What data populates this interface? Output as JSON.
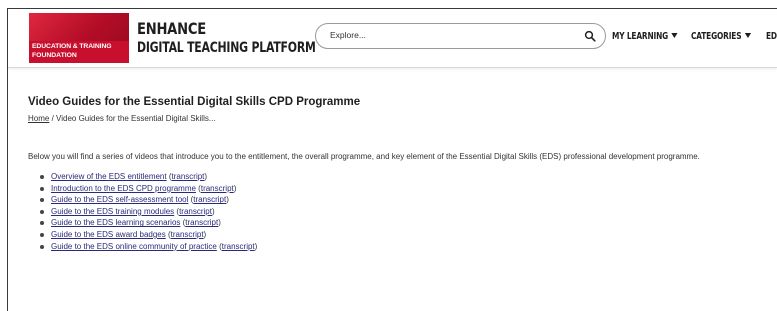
{
  "header": {
    "logo": {
      "line1": "EDUCATION & TRAINING",
      "line2": "FOUNDATION"
    },
    "brand_title": "ENHANCE",
    "brand_subtitle": "DIGITAL TEACHING PLATFORM",
    "search": {
      "placeholder": "Explore...",
      "icon": "search-icon"
    },
    "nav": [
      {
        "label": "MY LEARNING",
        "icon": "chevron-down-icon"
      },
      {
        "label": "CATEGORIES",
        "icon": "chevron-down-icon"
      },
      {
        "label": "EDS"
      }
    ]
  },
  "page": {
    "title": "Video Guides for the Essential Digital Skills CPD Programme",
    "breadcrumb": {
      "home": "Home",
      "separator": "/",
      "current": "Video Guides for the Essential Digital Skills..."
    },
    "intro": "Below you will find a series of videos that introduce you to the entitlement, the overall programme, and key element of the Essential Digital Skills (EDS) professional development programme.",
    "videos": [
      {
        "title": "Overview of the EDS entitlement",
        "transcript": "transcript"
      },
      {
        "title": "Introduction to the EDS CPD programme",
        "transcript": "transcript"
      },
      {
        "title": "Guide to the EDS self-assessment tool",
        "transcript": "transcript"
      },
      {
        "title": "Guide to the EDS training modules",
        "transcript": "transcript"
      },
      {
        "title": "Guide to the EDS learning scenarios",
        "transcript": "transcript"
      },
      {
        "title": "Guide to the EDS award badges",
        "transcript": "transcript"
      },
      {
        "title": "Guide to the EDS online community of practice",
        "transcript": "transcript"
      }
    ]
  },
  "colors": {
    "brand_red": "#c8102e",
    "link": "#2a2a7a"
  }
}
